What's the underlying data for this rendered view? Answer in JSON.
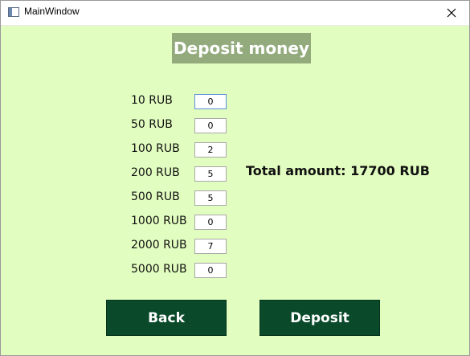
{
  "window": {
    "title": "MainWindow",
    "background": "#e2fdc0"
  },
  "header": {
    "title": "Deposit money",
    "background": "#93ab7c"
  },
  "denominations": [
    {
      "label": "10 RUB",
      "value": "0"
    },
    {
      "label": "50 RUB",
      "value": "0"
    },
    {
      "label": "100 RUB",
      "value": "2"
    },
    {
      "label": "200 RUB",
      "value": "5"
    },
    {
      "label": "500 RUB",
      "value": "5"
    },
    {
      "label": "1000 RUB",
      "value": "0"
    },
    {
      "label": "2000 RUB",
      "value": "7"
    },
    {
      "label": "5000 RUB",
      "value": "0"
    }
  ],
  "total": {
    "text": "Total amount: 17700 RUB"
  },
  "actions": {
    "back_label": "Back",
    "deposit_label": "Deposit",
    "button_color": "#0a4a2a"
  },
  "icons": {
    "app": "window-app-icon",
    "close": "close-icon"
  }
}
